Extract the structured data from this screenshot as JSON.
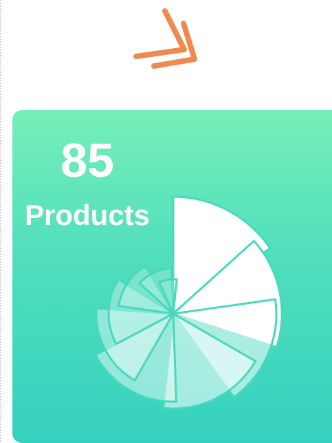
{
  "card": {
    "count": "85",
    "label": "Products"
  },
  "icons": {
    "top": "double-chevron-icon",
    "card_graphic": "radial-wedge-spiral-icon"
  },
  "colors": {
    "accent": "#ef8a4f",
    "card_top": "#76efb9",
    "card_bottom": "#35d1bf",
    "text": "#ffffff"
  }
}
